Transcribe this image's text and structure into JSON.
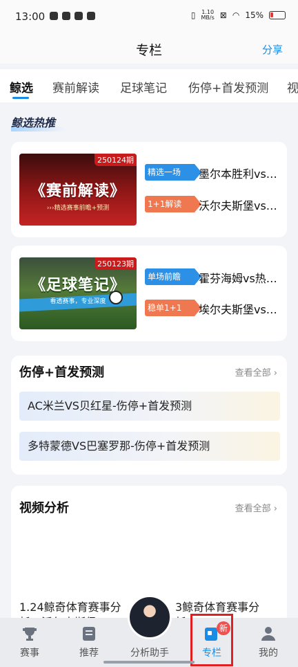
{
  "status_bar": {
    "time": "13:00",
    "speed_value": "1.10",
    "speed_unit": "MB/s",
    "battery": "15%"
  },
  "header": {
    "title": "专栏",
    "share_label": "分享"
  },
  "tabs": [
    {
      "label": "鲸选",
      "active": true
    },
    {
      "label": "赛前解读",
      "active": false
    },
    {
      "label": "足球笔记",
      "active": false
    },
    {
      "label": "伤停+首发预测",
      "active": false
    },
    {
      "label": "视",
      "active": false
    }
  ],
  "featured": {
    "title": "鲸选热推",
    "cards": [
      {
        "issue": "250124期",
        "thumb_title": "《赛前解读》",
        "thumb_subtitle": "›››精选赛事前瞻+预测",
        "items": [
          {
            "tag": "精选一场",
            "tag_color": "#2b90e6",
            "match": "墨尔本胜利vs…"
          },
          {
            "tag": "1+1解读",
            "tag_color": "#f07850",
            "match": "沃尔夫斯堡vs…"
          }
        ]
      },
      {
        "issue": "250123期",
        "thumb_title": "《足球笔记》",
        "thumb_subtitle": "看透赛事，专业深度",
        "items": [
          {
            "tag": "单场前瞻",
            "tag_color": "#2b90e6",
            "match": "霍芬海姆vs热…"
          },
          {
            "tag": "稳单1+1",
            "tag_color": "#f07850",
            "match": "埃尔夫斯堡vs…"
          }
        ]
      }
    ]
  },
  "prediction_section": {
    "title": "伤停+首发预测",
    "see_all": "查看全部",
    "items": [
      "AC米兰VS贝红星-伤停+首发预测",
      "多特蒙德VS巴塞罗那-伤停+首发预测"
    ]
  },
  "video_section": {
    "title": "视频分析",
    "see_all": "查看全部",
    "items": [
      {
        "line1": "1.24鲸奇体育赛事分",
        "line2": "析：沃尔夫斯堡vs..."
      },
      {
        "line1": "3鲸奇体育赛事分",
        "line2": "析：..."
      }
    ]
  },
  "bottom_nav": [
    {
      "label": "赛事",
      "icon": "trophy-icon"
    },
    {
      "label": "推荐",
      "icon": "document-icon"
    },
    {
      "label": "分析助手",
      "icon": "assistant-avatar"
    },
    {
      "label": "专栏",
      "icon": "column-icon",
      "active": true,
      "badge": "新"
    },
    {
      "label": "我的",
      "icon": "user-icon"
    }
  ],
  "colors": {
    "accent": "#1a8ce6",
    "tag_blue": "#2b90e6",
    "tag_orange": "#f07850",
    "highlight": "#e02020"
  }
}
